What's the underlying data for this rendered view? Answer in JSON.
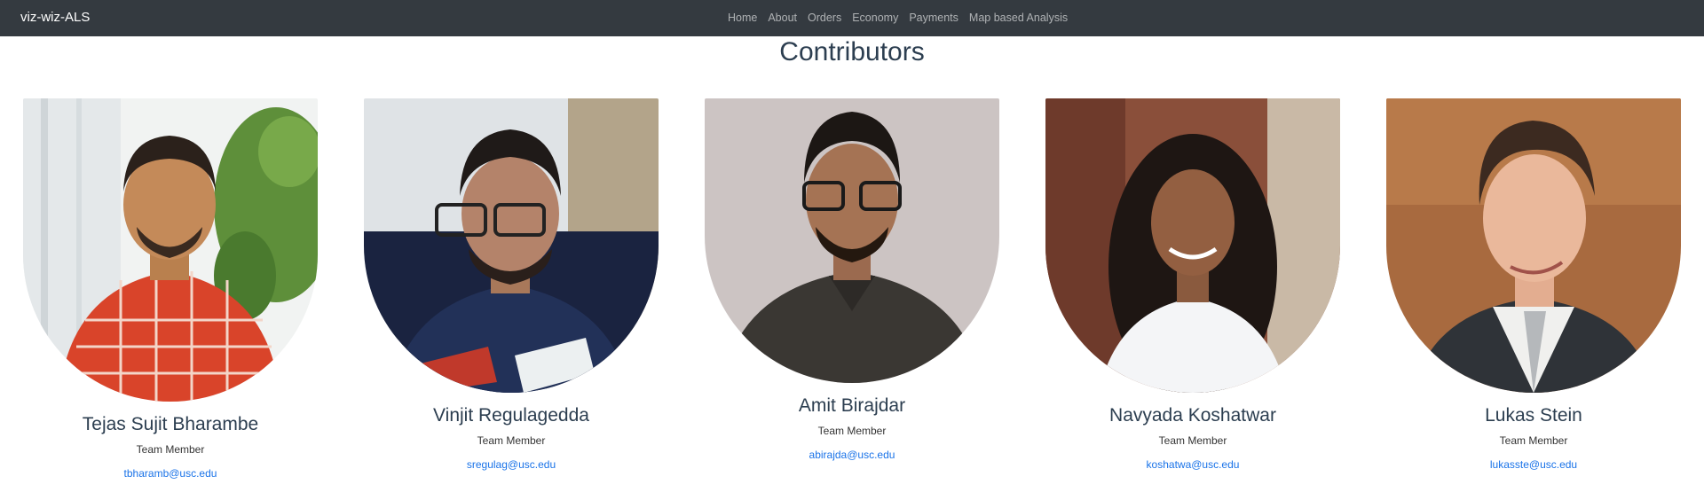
{
  "brand": "viz-wiz-ALS",
  "nav": [
    "Home",
    "About",
    "Orders",
    "Economy",
    "Payments",
    "Map based Analysis"
  ],
  "title": "Contributors",
  "contributors": [
    {
      "name": "Tejas Sujit Bharambe",
      "role": "Team Member",
      "email": "tbharamb@usc.edu"
    },
    {
      "name": "Vinjit Regulagedda",
      "role": "Team Member",
      "email": "sregulag@usc.edu"
    },
    {
      "name": "Amit Birajdar",
      "role": "Team Member",
      "email": "abirajda@usc.edu"
    },
    {
      "name": "Navyada Koshatwar",
      "role": "Team Member",
      "email": "koshatwa@usc.edu"
    },
    {
      "name": "Lukas Stein",
      "role": "Team Member",
      "email": "lukasste@usc.edu"
    }
  ],
  "colors": {
    "navbar": "#343a40",
    "title": "#2c3e50",
    "link": "#1a73e8"
  }
}
